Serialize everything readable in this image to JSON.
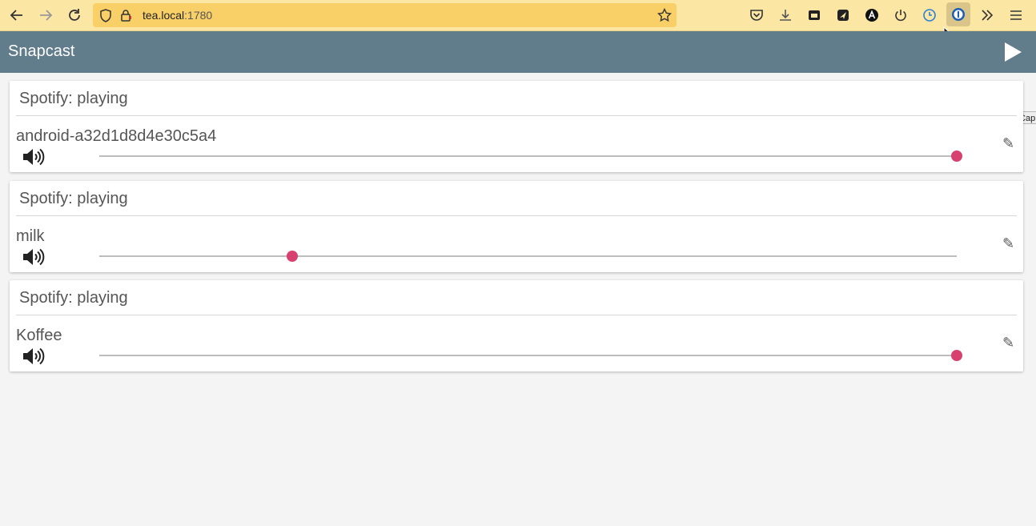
{
  "browser": {
    "url_host": "tea.local",
    "url_port": ":1780",
    "tooltip": "More Cap"
  },
  "app": {
    "title": "Snapcast",
    "accent_color": "#d6416f",
    "header_color": "#617d8c"
  },
  "groups": [
    {
      "status": "Spotify: playing",
      "client": "android-a32d1d8d4e30c5a4",
      "volume": 1.0
    },
    {
      "status": "Spotify: playing",
      "client": "milk",
      "volume": 0.225
    },
    {
      "status": "Spotify: playing",
      "client": "Koffee",
      "volume": 1.0
    }
  ],
  "icons": {
    "speaker": "speaker-volume-icon",
    "edit": "pencil-icon",
    "play": "play-icon"
  }
}
